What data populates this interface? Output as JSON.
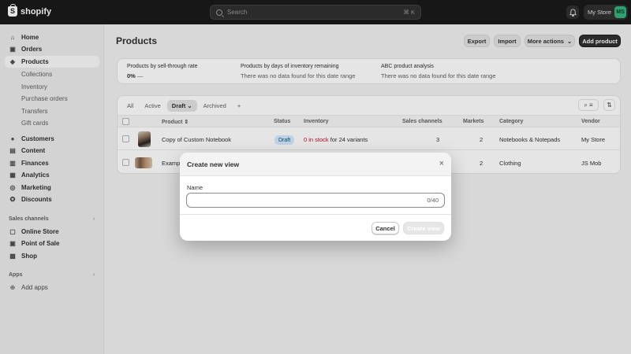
{
  "topbar": {
    "brand": "shopify",
    "brand_mark": "S",
    "search_placeholder": "Search",
    "search_shortcut": "⌘ K",
    "bell_icon": "bell-icon",
    "store_name": "My Store",
    "avatar_initials": "MS"
  },
  "sidebar": {
    "items": [
      {
        "label": "Home",
        "icon": "⌂"
      },
      {
        "label": "Orders",
        "icon": "▣"
      },
      {
        "label": "Products",
        "icon": "◈"
      }
    ],
    "product_sub": [
      "Collections",
      "Inventory",
      "Purchase orders",
      "Transfers",
      "Gift cards"
    ],
    "items2": [
      {
        "label": "Customers",
        "icon": "●"
      },
      {
        "label": "Content",
        "icon": "▤"
      },
      {
        "label": "Finances",
        "icon": "▥"
      },
      {
        "label": "Analytics",
        "icon": "▦"
      },
      {
        "label": "Marketing",
        "icon": "◎"
      },
      {
        "label": "Discounts",
        "icon": "✪"
      }
    ],
    "sales_channels_label": "Sales channels",
    "channels": [
      {
        "label": "Online Store",
        "icon": "▢"
      },
      {
        "label": "Point of Sale",
        "icon": "▣"
      },
      {
        "label": "Shop",
        "icon": "▩"
      }
    ],
    "apps_label": "Apps",
    "add_apps": {
      "label": "Add apps",
      "icon": "⊕"
    }
  },
  "main": {
    "title": "Products",
    "buttons": {
      "export": "Export",
      "import": "Import",
      "more_actions": "More actions",
      "add_product": "Add product"
    },
    "analytics": [
      {
        "title": "Products by sell-through rate",
        "value_bold": "0%",
        "value": "—"
      },
      {
        "title": "Products by days of inventory remaining",
        "value_bold": "",
        "value": "There was no data found for this date range"
      },
      {
        "title": "ABC product analysis",
        "value_bold": "",
        "value": "There was no data found for this date range"
      }
    ],
    "tabs": [
      {
        "label": "All"
      },
      {
        "label": "Active"
      },
      {
        "label": "Draft ⌄",
        "active": true
      },
      {
        "label": "Archived"
      },
      {
        "label": "+"
      }
    ],
    "tools": {
      "search_filter": "⌕ ≡",
      "sort": "⇅"
    },
    "columns": {
      "product": "Product ⇕",
      "status": "Status",
      "inventory": "Inventory",
      "sales_channels": "Sales channels",
      "markets": "Markets",
      "category": "Category",
      "vendor": "Vendor"
    },
    "rows": [
      {
        "product": "Copy of Custom Notebook",
        "status": "Draft",
        "inventory_red": "0 in stock",
        "inventory_rest": " for 24 variants",
        "sales_channels": "3",
        "markets": "2",
        "category": "Notebooks & Notepads",
        "vendor": "My Store"
      },
      {
        "product": "Examp",
        "status": "",
        "inventory_red": "",
        "inventory_rest": "",
        "sales_channels": "",
        "markets": "2",
        "category": "Clothing",
        "vendor": "JS Mob"
      }
    ]
  },
  "modal": {
    "title": "Create new view",
    "close_icon": "×",
    "name_label": "Name",
    "name_value": "",
    "char_count": "0/40",
    "cancel": "Cancel",
    "create": "Create view"
  }
}
